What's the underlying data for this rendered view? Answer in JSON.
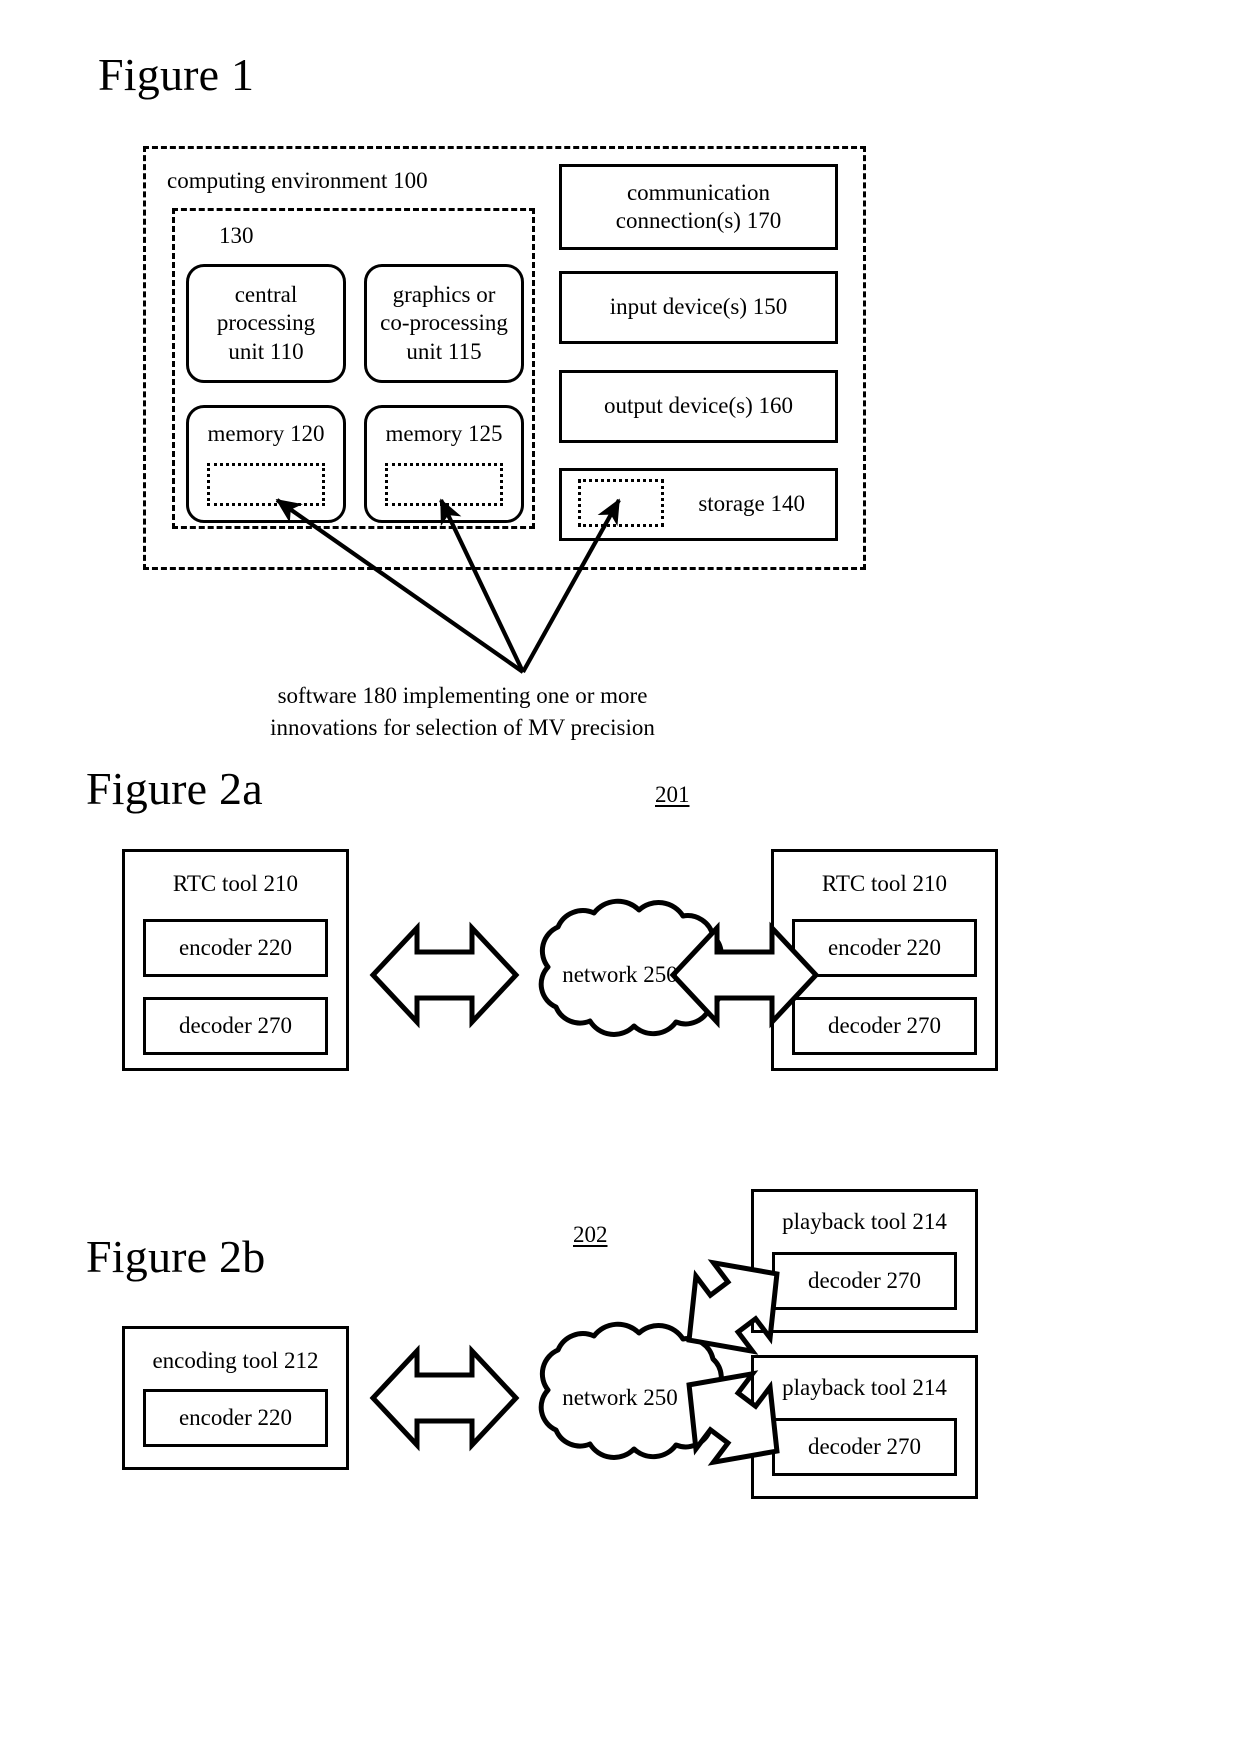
{
  "figures": {
    "fig1": {
      "title": "Figure 1",
      "outer_label": "computing environment 100",
      "inner_label": "130",
      "cpu": {
        "line1": "central",
        "line2": "processing",
        "line3": "unit 110"
      },
      "gpu": {
        "line1": "graphics or",
        "line2": "co-processing",
        "line3": "unit 115"
      },
      "memory1": "memory 120",
      "memory2": "memory 125",
      "communication": {
        "line1": "communication",
        "line2": "connection(s) 170"
      },
      "input_devices": "input device(s) 150",
      "output_devices": "output device(s) 160",
      "storage": "storage 140",
      "caption_line1": "software 180 implementing one or more",
      "caption_line2": "innovations for selection of MV precision"
    },
    "fig2a": {
      "title": "Figure 2a",
      "ref": "201",
      "left_tool": {
        "title": "RTC tool 210",
        "encoder": "encoder 220",
        "decoder": "decoder 270"
      },
      "right_tool": {
        "title": "RTC tool 210",
        "encoder": "encoder 220",
        "decoder": "decoder 270"
      },
      "network": "network 250"
    },
    "fig2b": {
      "title": "Figure 2b",
      "ref": "202",
      "encoding_tool": {
        "title": "encoding tool 212",
        "encoder": "encoder 220"
      },
      "network": "network 250",
      "playback_top": {
        "title": "playback tool 214",
        "decoder": "decoder 270"
      },
      "playback_bottom": {
        "title": "playback tool 214",
        "decoder": "decoder 270"
      }
    }
  },
  "colors": {
    "ink": "#000000",
    "paper": "#ffffff"
  }
}
